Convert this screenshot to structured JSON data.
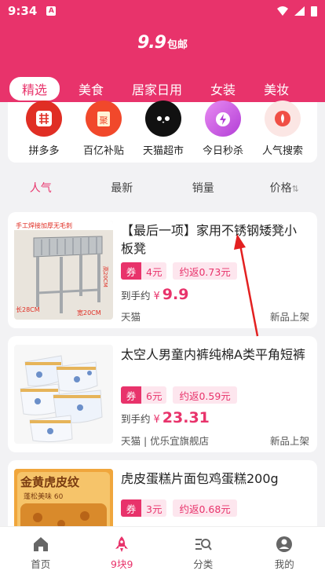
{
  "status": {
    "time": "9:34",
    "badge": "A"
  },
  "header": {
    "logo_main": "9.9",
    "logo_sub": "包邮",
    "tabs": [
      "精选",
      "美食",
      "居家日用",
      "女装",
      "美妆"
    ]
  },
  "categories": [
    {
      "label": "拼多多",
      "icon": "pinduoduo-icon",
      "color": "#e02e24"
    },
    {
      "label": "百亿补贴",
      "icon": "subsidy-icon",
      "color": "#f1482b"
    },
    {
      "label": "天猫超市",
      "icon": "tmall-icon",
      "color": "#111111"
    },
    {
      "label": "今日秒杀",
      "icon": "flash-sale-icon",
      "color": "#c45ad8"
    },
    {
      "label": "人气搜索",
      "icon": "hot-search-icon",
      "color": "#f04f45"
    }
  ],
  "sort": [
    "人气",
    "最新",
    "销量",
    "价格"
  ],
  "products": [
    {
      "title": "【最后一项】家用不锈钢矮凳小板凳",
      "coupon_label": "券",
      "coupon_value": "4元",
      "rebate": "约返0.73元",
      "price_label": "到手约",
      "currency": "¥",
      "price": "9.9",
      "shop": "天猫",
      "tag": "新品上架",
      "image_text": {
        "banner": "手工焊接加厚无毛刺",
        "height": "高20CM",
        "length": "长28CM",
        "width": "宽20CM"
      }
    },
    {
      "title": "太空人男童内裤纯棉A类平角短裤",
      "coupon_label": "券",
      "coupon_value": "6元",
      "rebate": "约返0.59元",
      "price_label": "到手约",
      "currency": "¥",
      "price": "23.31",
      "shop": "天猫 | 优乐宜旗舰店",
      "tag": "新品上架"
    },
    {
      "title": "虎皮蛋糕片面包鸡蛋糕200g",
      "coupon_label": "券",
      "coupon_value": "3元",
      "rebate": "约返0.68元",
      "image_text": {
        "line1": "金黄虎皮纹",
        "line2": "蓬松美味 60"
      }
    }
  ],
  "nav": [
    {
      "label": "首页",
      "icon": "home-icon"
    },
    {
      "label": "9块9",
      "icon": "rocket-icon"
    },
    {
      "label": "分类",
      "icon": "category-search-icon"
    },
    {
      "label": "我的",
      "icon": "user-icon"
    }
  ],
  "colors": {
    "brand": "#e8336b",
    "brand_light": "#fde6ee"
  }
}
